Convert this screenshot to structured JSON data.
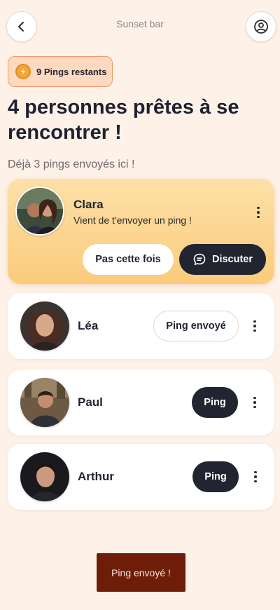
{
  "header": {
    "venue_name": "Sunset bar",
    "back_icon": "chevron-left-icon",
    "profile_icon": "user-circle-icon"
  },
  "pings_badge": {
    "label": "9 Pings restants",
    "icon": "lightning-coin-icon"
  },
  "title": "4 personnes prêtes à se rencontrer !",
  "subtitle": "Déjà 3 pings envoyés ici !",
  "featured": {
    "name": "Clara",
    "message": "Vient de t'envoyer un ping !",
    "decline_label": "Pas cette fois",
    "chat_label": "Discuter",
    "chat_icon": "chat-bubble-icon"
  },
  "people": [
    {
      "name": "Léa",
      "action_label": "Ping envoyé",
      "state": "sent"
    },
    {
      "name": "Paul",
      "action_label": "Ping",
      "state": "ready"
    },
    {
      "name": "Arthur",
      "action_label": "Ping",
      "state": "ready"
    }
  ],
  "toast": "Ping envoyé !",
  "colors": {
    "background": "#fdf1e8",
    "accent_dark": "#22242f",
    "featured_gradient_top": "#fde0a8",
    "featured_gradient_bottom": "#fccb7c",
    "badge_border": "#ef9d68",
    "toast_bg": "#6e1d08"
  }
}
